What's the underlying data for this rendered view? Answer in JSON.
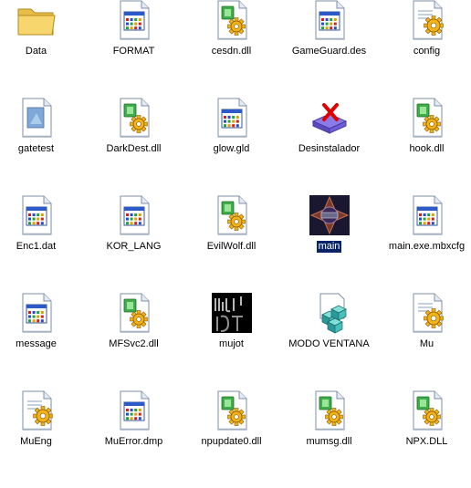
{
  "folder": {
    "items": [
      {
        "name": "Data",
        "icon": "folder-icon"
      },
      {
        "name": "FORMAT",
        "icon": "application-window-icon"
      },
      {
        "name": "cesdn.dll",
        "icon": "dll-gear-icon"
      },
      {
        "name": "GameGuard.des",
        "icon": "application-window-icon"
      },
      {
        "name": "config",
        "icon": "config-settings-icon"
      },
      {
        "name": "gatetest",
        "icon": "generic-file-icon"
      },
      {
        "name": "DarkDest.dll",
        "icon": "dll-gear-icon"
      },
      {
        "name": "glow.gld",
        "icon": "application-window-icon"
      },
      {
        "name": "Desinstalador",
        "icon": "uninstaller-icon"
      },
      {
        "name": "hook.dll",
        "icon": "dll-gear-icon"
      },
      {
        "name": "Enc1.dat",
        "icon": "application-window-icon"
      },
      {
        "name": "KOR_LANG",
        "icon": "application-window-icon"
      },
      {
        "name": "EvilWolf.dll",
        "icon": "dll-gear-icon"
      },
      {
        "name": "main",
        "icon": "main-game-icon",
        "selected": true
      },
      {
        "name": "main.exe.mbxcfg",
        "icon": "application-window-icon"
      },
      {
        "name": "message",
        "icon": "application-window-icon"
      },
      {
        "name": "MFSvc2.dll",
        "icon": "dll-gear-icon"
      },
      {
        "name": "mujot",
        "icon": "mujot-image-icon"
      },
      {
        "name": "MODO VENTANA",
        "icon": "registry-cubes-icon"
      },
      {
        "name": "Mu",
        "icon": "config-settings-icon"
      },
      {
        "name": "MuEng",
        "icon": "config-settings-icon"
      },
      {
        "name": "MuError.dmp",
        "icon": "application-window-icon"
      },
      {
        "name": "npupdate0.dll",
        "icon": "dll-gear-icon"
      },
      {
        "name": "mumsg.dll",
        "icon": "dll-gear-icon"
      },
      {
        "name": "NPX.DLL",
        "icon": "dll-gear-icon"
      }
    ]
  },
  "colors": {
    "selection_background": "#0a246a",
    "selection_text": "#ffffff"
  }
}
